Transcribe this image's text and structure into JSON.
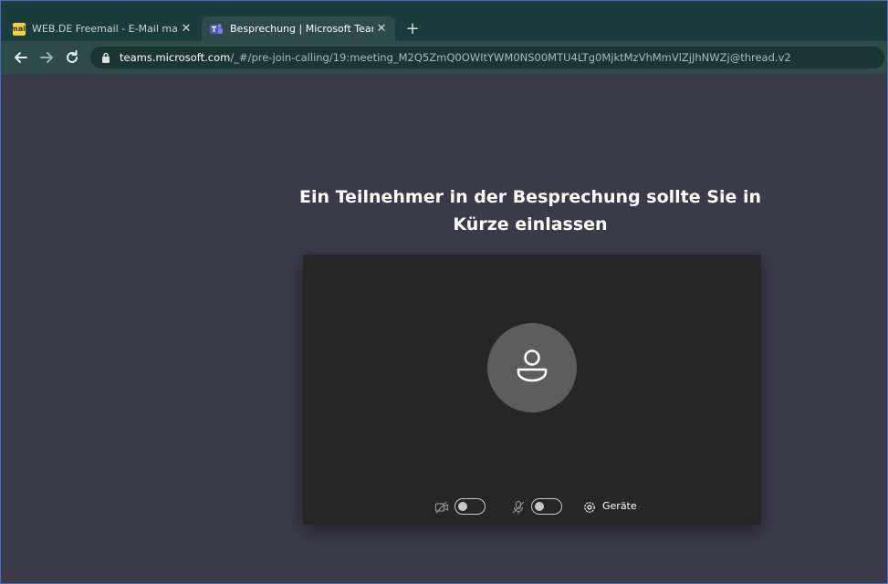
{
  "browser": {
    "tabs": [
      {
        "title": "WEB.DE Freemail - E-Mail made in Germany",
        "favicon": "webde-icon",
        "active": false
      },
      {
        "title": "Besprechung | Microsoft Teams",
        "favicon": "teams-icon",
        "active": true
      }
    ],
    "new_tab": "+",
    "close_symbol": "✕",
    "favicon_webde_text": "mail",
    "url_host": "teams.microsoft.com",
    "url_path": "/_#/pre-join-calling/19:meeting_M2Q5ZmQ0OWItYWM0NS00MTU4LTg0MjktMzVhMmVlZjJhNWZj@thread.v2"
  },
  "meeting": {
    "heading_line1": "Ein Teilnehmer in der Besprechung sollte Sie in",
    "heading_line2": "Kürze einlassen",
    "devices_label": "Geräte",
    "camera_on": false,
    "mic_on": false
  },
  "colors": {
    "background": "#3b3a49",
    "tab_strip": "#1b3c3c",
    "toolbar": "#2e4a4a",
    "preview": "#262626",
    "avatar": "#5d5d5d"
  }
}
